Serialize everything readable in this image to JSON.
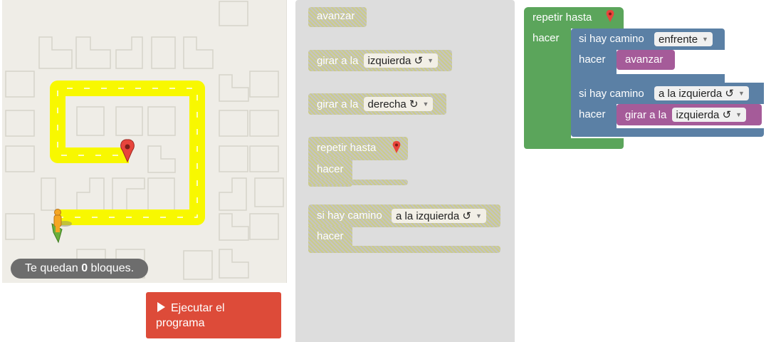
{
  "maze": {
    "status_prefix": "Te quedan",
    "remaining_blocks": "0",
    "status_suffix": "bloques.",
    "colors": {
      "path": "#f8f800",
      "background": "#efede7",
      "goal": "#e8453c",
      "player": "#f59e0b"
    }
  },
  "run_button": {
    "label": "Ejecutar el programa",
    "icon": "play-icon",
    "color": "#dd4b39"
  },
  "toolbox": {
    "move_forward": "avanzar",
    "turn_left_label": "girar a la",
    "turn_left_option": "izquierda ↺",
    "turn_right_label": "girar a la",
    "turn_right_option": "derecha ↻",
    "repeat_label": "repetir hasta",
    "repeat_do": "hacer",
    "if_label": "si hay camino",
    "if_option": "a la izquierda ↺",
    "if_do": "hacer"
  },
  "workspace": {
    "repeat_label": "repetir hasta",
    "repeat_do": "hacer",
    "if1_label": "si hay camino",
    "if1_option": "enfrente",
    "if1_do": "hacer",
    "if1_action": "avanzar",
    "if2_label": "si hay camino",
    "if2_option": "a la izquierda ↺",
    "if2_do": "hacer",
    "if2_action_label": "girar a la",
    "if2_action_option": "izquierda ↺",
    "colors": {
      "loop": "#5ba55b",
      "logic": "#5b80a5",
      "movement": "#a55b99"
    }
  }
}
